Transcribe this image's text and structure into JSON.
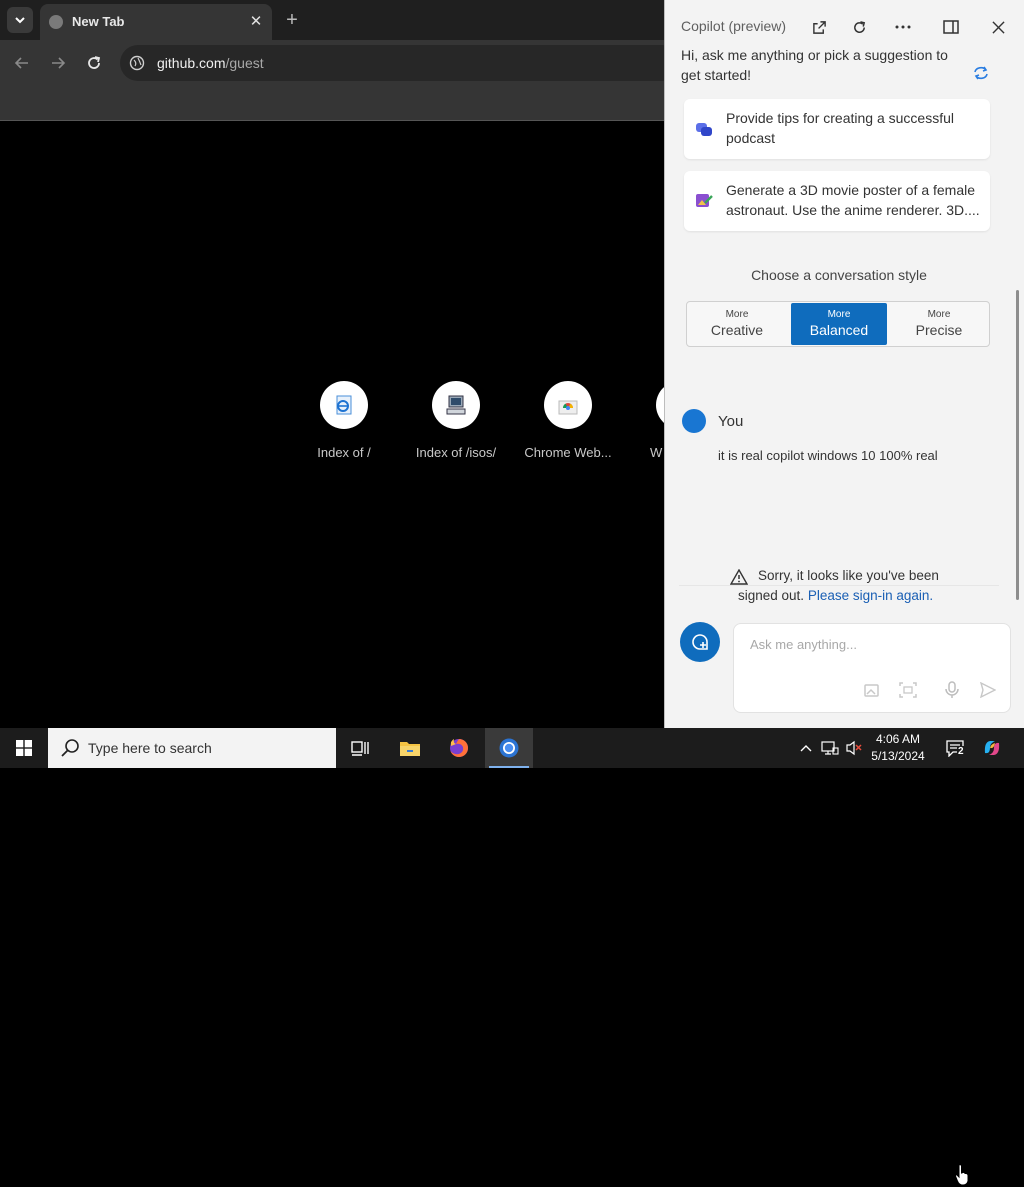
{
  "browser": {
    "tab": {
      "title": "New Tab",
      "close_glyph": "✕",
      "favicon": "globe-icon"
    },
    "new_tab_glyph": "+",
    "tab_list_icon": "chevron-down-icon",
    "nav": {
      "back_icon": "arrow-left-icon",
      "forward_icon": "arrow-right-icon",
      "reload_icon": "reload-icon"
    },
    "omnibox": {
      "host": "github.com",
      "path": "/guest",
      "site_icon": "site-info-icon"
    },
    "shortcuts": [
      {
        "label": "Index of /",
        "icon": "ie-page-icon"
      },
      {
        "label": "Index of /isos/",
        "icon": "computer-icon"
      },
      {
        "label": "Chrome Web...",
        "icon": "chrome-web-store-icon"
      },
      {
        "label": "W",
        "icon": "generic-site-icon"
      }
    ]
  },
  "copilot": {
    "title": "Copilot (preview)",
    "header_icons": [
      "open-external-icon",
      "refresh-icon",
      "more-icon",
      "split-view-icon",
      "close-icon"
    ],
    "greeting": "Hi, ask me anything or pick a suggestion to get started!",
    "suggestions": [
      {
        "text": "Provide tips for creating a successful podcast",
        "icon": "chat-bubbles-icon"
      },
      {
        "text": "Generate a 3D movie poster of a female astronaut. Use the anime renderer. 3D....",
        "icon": "image-create-icon"
      }
    ],
    "style_label": "Choose a conversation style",
    "styles": [
      {
        "small": "More",
        "big": "Creative",
        "active": false
      },
      {
        "small": "More",
        "big": "Balanced",
        "active": true
      },
      {
        "small": "More",
        "big": "Precise",
        "active": false
      }
    ],
    "user": {
      "name": "You",
      "message": "it is real copilot windows 10 100% real"
    },
    "signin_warning": {
      "text": "Sorry, it looks like you've been signed out.",
      "link": "Please sign-in again."
    },
    "input": {
      "placeholder": "Ask me anything..."
    },
    "accent": "#0f6cbd"
  },
  "taskbar": {
    "search_text": "Type here to search",
    "time": "4:06 AM",
    "date": "5/13/2024",
    "notification_count": "2",
    "apps": [
      "task-view-icon",
      "file-explorer-icon",
      "firefox-icon",
      "chrome-icon"
    ]
  }
}
